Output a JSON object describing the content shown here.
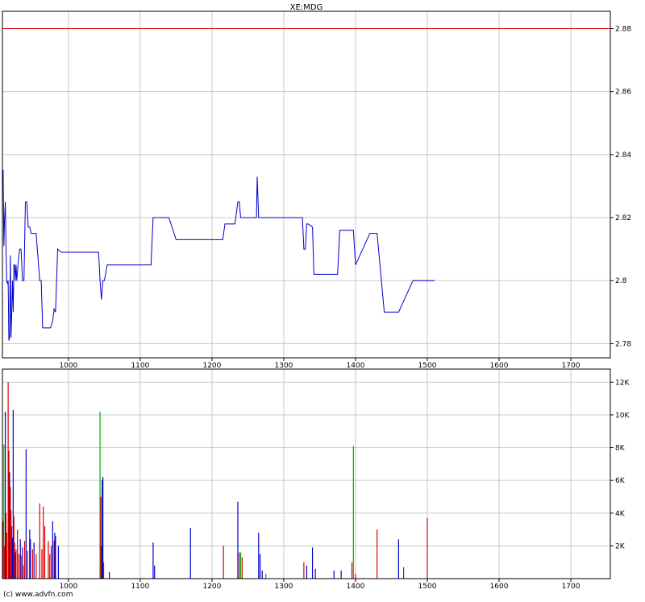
{
  "chart_data": [
    {
      "type": "line",
      "title": "XE:MDG",
      "xlim": [
        908,
        1755
      ],
      "ylim": [
        2.7755,
        2.8855
      ],
      "xticks": [
        1000,
        1100,
        1200,
        1300,
        1400,
        1500,
        1600,
        1700
      ],
      "yticks": [
        2.78,
        2.8,
        2.82,
        2.84,
        2.86,
        2.88
      ],
      "ytick_labels": [
        "2.78",
        "2.8",
        "2.82",
        "2.84",
        "2.86",
        "2.88"
      ],
      "reference_line": 2.88,
      "grid": true,
      "colors": {
        "line": "#0000cc",
        "reference": "#dd0000",
        "grid": "#c8c8c8"
      },
      "series": [
        {
          "x": [
            908,
            909,
            910,
            911,
            912,
            913,
            914,
            915,
            916,
            917,
            918,
            919,
            920,
            921,
            922,
            923,
            924,
            925,
            926,
            927,
            928,
            930,
            932,
            934,
            936,
            938,
            940,
            942,
            944,
            946,
            948,
            950,
            955,
            960,
            962,
            964,
            966,
            975,
            978,
            980,
            982,
            985,
            990,
            1000,
            1010,
            1030,
            1042,
            1044,
            1046,
            1048,
            1050,
            1054,
            1057,
            1060,
            1080,
            1100,
            1115,
            1118,
            1125,
            1140,
            1150,
            1165,
            1180,
            1200,
            1215,
            1218,
            1232,
            1236,
            1238,
            1240,
            1242,
            1250,
            1260,
            1262,
            1263,
            1265,
            1270,
            1290,
            1305,
            1320,
            1326,
            1328,
            1330,
            1332,
            1334,
            1340,
            1342,
            1345,
            1375,
            1378,
            1390,
            1395,
            1397,
            1400,
            1420,
            1425,
            1427,
            1430,
            1440,
            1455,
            1460,
            1480,
            1490,
            1500,
            1510
          ],
          "y": [
            2.835,
            2.835,
            2.811,
            2.82,
            2.825,
            2.81,
            2.8,
            2.799,
            2.8,
            2.781,
            2.782,
            2.808,
            2.782,
            2.79,
            2.8,
            2.79,
            2.805,
            2.805,
            2.8,
            2.805,
            2.8,
            2.806,
            2.81,
            2.81,
            2.8,
            2.8,
            2.825,
            2.825,
            2.817,
            2.817,
            2.815,
            2.815,
            2.815,
            2.8,
            2.8,
            2.785,
            2.785,
            2.785,
            2.787,
            2.791,
            2.79,
            2.81,
            2.809,
            2.809,
            2.809,
            2.809,
            2.809,
            2.8,
            2.794,
            2.8,
            2.8,
            2.805,
            2.805,
            2.805,
            2.805,
            2.805,
            2.805,
            2.82,
            2.82,
            2.82,
            2.813,
            2.813,
            2.813,
            2.813,
            2.813,
            2.818,
            2.818,
            2.825,
            2.825,
            2.82,
            2.82,
            2.82,
            2.82,
            2.82,
            2.833,
            2.82,
            2.82,
            2.82,
            2.82,
            2.82,
            2.82,
            2.81,
            2.81,
            2.818,
            2.818,
            2.817,
            2.802,
            2.802,
            2.802,
            2.816,
            2.816,
            2.816,
            2.816,
            2.805,
            2.815,
            2.815,
            2.815,
            2.815,
            2.79,
            2.79,
            2.79,
            2.8,
            2.8,
            2.8,
            2.8
          ]
        }
      ]
    },
    {
      "type": "bar",
      "xlim": [
        908,
        1755
      ],
      "ylim": [
        0,
        12800
      ],
      "xticks": [
        1000,
        1100,
        1200,
        1300,
        1400,
        1500,
        1600,
        1700
      ],
      "yticks": [
        2000,
        4000,
        6000,
        8000,
        10000,
        12000
      ],
      "ytick_labels": [
        "2K",
        "4K",
        "6K",
        "8K",
        "10K",
        "12K"
      ],
      "grid": true,
      "colors": {
        "neutral": "#0000cc",
        "down": "#dd0000",
        "up": "#00aa00",
        "grid": "#c8c8c8"
      },
      "bars": [
        {
          "x": 909,
          "v": 3500,
          "c": "down"
        },
        {
          "x": 910,
          "v": 8200,
          "c": "up"
        },
        {
          "x": 911,
          "v": 2000,
          "c": "down"
        },
        {
          "x": 912,
          "v": 10200,
          "c": "neutral"
        },
        {
          "x": 913,
          "v": 4000,
          "c": "down"
        },
        {
          "x": 914,
          "v": 2800,
          "c": "down"
        },
        {
          "x": 916,
          "v": 12000,
          "c": "down"
        },
        {
          "x": 917,
          "v": 7800,
          "c": "down"
        },
        {
          "x": 918,
          "v": 6500,
          "c": "neutral"
        },
        {
          "x": 919,
          "v": 5600,
          "c": "down"
        },
        {
          "x": 920,
          "v": 4200,
          "c": "down"
        },
        {
          "x": 921,
          "v": 3200,
          "c": "down"
        },
        {
          "x": 922,
          "v": 2500,
          "c": "neutral"
        },
        {
          "x": 923,
          "v": 10300,
          "c": "neutral"
        },
        {
          "x": 924,
          "v": 3800,
          "c": "down"
        },
        {
          "x": 925,
          "v": 2200,
          "c": "down"
        },
        {
          "x": 926,
          "v": 1600,
          "c": "neutral"
        },
        {
          "x": 927,
          "v": 1800,
          "c": "down"
        },
        {
          "x": 929,
          "v": 3000,
          "c": "down"
        },
        {
          "x": 931,
          "v": 1500,
          "c": "down"
        },
        {
          "x": 933,
          "v": 2400,
          "c": "neutral"
        },
        {
          "x": 934,
          "v": 1400,
          "c": "down"
        },
        {
          "x": 936,
          "v": 1900,
          "c": "neutral"
        },
        {
          "x": 937,
          "v": 800,
          "c": "down"
        },
        {
          "x": 939,
          "v": 2300,
          "c": "down"
        },
        {
          "x": 941,
          "v": 7900,
          "c": "neutral"
        },
        {
          "x": 943,
          "v": 1700,
          "c": "down"
        },
        {
          "x": 946,
          "v": 3000,
          "c": "neutral"
        },
        {
          "x": 947,
          "v": 2400,
          "c": "neutral"
        },
        {
          "x": 950,
          "v": 1800,
          "c": "down"
        },
        {
          "x": 952,
          "v": 2200,
          "c": "neutral"
        },
        {
          "x": 955,
          "v": 1500,
          "c": "down"
        },
        {
          "x": 960,
          "v": 4600,
          "c": "down"
        },
        {
          "x": 963,
          "v": 1800,
          "c": "down"
        },
        {
          "x": 965,
          "v": 4400,
          "c": "down"
        },
        {
          "x": 967,
          "v": 3200,
          "c": "down"
        },
        {
          "x": 972,
          "v": 2300,
          "c": "down"
        },
        {
          "x": 974,
          "v": 1500,
          "c": "down"
        },
        {
          "x": 976,
          "v": 2000,
          "c": "down"
        },
        {
          "x": 978,
          "v": 3500,
          "c": "neutral"
        },
        {
          "x": 980,
          "v": 2300,
          "c": "down"
        },
        {
          "x": 981,
          "v": 2800,
          "c": "neutral"
        },
        {
          "x": 982,
          "v": 2600,
          "c": "neutral"
        },
        {
          "x": 986,
          "v": 2000,
          "c": "neutral"
        },
        {
          "x": 1044,
          "v": 10200,
          "c": "up"
        },
        {
          "x": 1045,
          "v": 5000,
          "c": "down"
        },
        {
          "x": 1046,
          "v": 2000,
          "c": "down"
        },
        {
          "x": 1047,
          "v": 6000,
          "c": "neutral"
        },
        {
          "x": 1048,
          "v": 6200,
          "c": "neutral"
        },
        {
          "x": 1049,
          "v": 1000,
          "c": "down"
        },
        {
          "x": 1057,
          "v": 400,
          "c": "neutral"
        },
        {
          "x": 1118,
          "v": 2200,
          "c": "neutral"
        },
        {
          "x": 1120,
          "v": 800,
          "c": "neutral"
        },
        {
          "x": 1170,
          "v": 3100,
          "c": "neutral"
        },
        {
          "x": 1216,
          "v": 2000,
          "c": "down"
        },
        {
          "x": 1236,
          "v": 4700,
          "c": "neutral"
        },
        {
          "x": 1238,
          "v": 1600,
          "c": "down"
        },
        {
          "x": 1240,
          "v": 1600,
          "c": "up"
        },
        {
          "x": 1242,
          "v": 1300,
          "c": "down"
        },
        {
          "x": 1265,
          "v": 2800,
          "c": "neutral"
        },
        {
          "x": 1267,
          "v": 1500,
          "c": "neutral"
        },
        {
          "x": 1270,
          "v": 500,
          "c": "neutral"
        },
        {
          "x": 1275,
          "v": 300,
          "c": "up"
        },
        {
          "x": 1328,
          "v": 1000,
          "c": "down"
        },
        {
          "x": 1332,
          "v": 800,
          "c": "neutral"
        },
        {
          "x": 1340,
          "v": 1900,
          "c": "neutral"
        },
        {
          "x": 1344,
          "v": 600,
          "c": "neutral"
        },
        {
          "x": 1370,
          "v": 500,
          "c": "neutral"
        },
        {
          "x": 1380,
          "v": 500,
          "c": "neutral"
        },
        {
          "x": 1395,
          "v": 1000,
          "c": "down"
        },
        {
          "x": 1397,
          "v": 8100,
          "c": "up"
        },
        {
          "x": 1400,
          "v": 300,
          "c": "down"
        },
        {
          "x": 1430,
          "v": 3000,
          "c": "down"
        },
        {
          "x": 1460,
          "v": 2400,
          "c": "neutral"
        },
        {
          "x": 1467,
          "v": 700,
          "c": "down"
        },
        {
          "x": 1500,
          "v": 3700,
          "c": "down"
        }
      ]
    }
  ],
  "footer": "(c) www.advfn.com"
}
